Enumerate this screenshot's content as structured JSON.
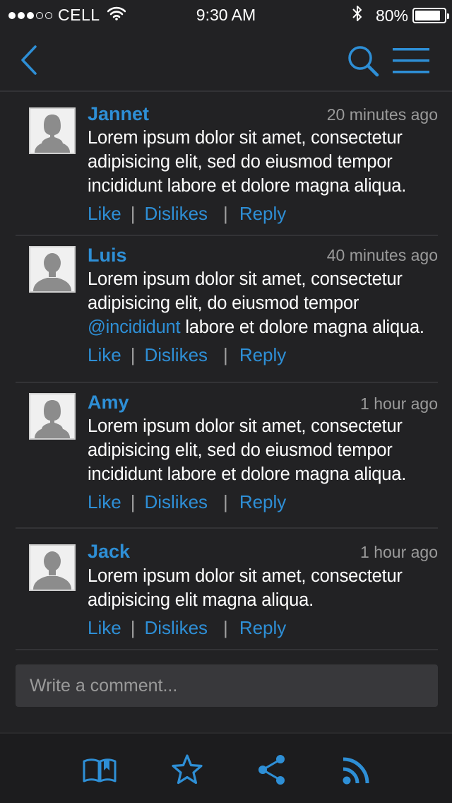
{
  "status_bar": {
    "carrier": "CELL",
    "time": "9:30 AM",
    "battery": "80%",
    "signal_icon": "signal-dots-icon",
    "wifi_icon": "wifi-icon",
    "bluetooth_icon": "bluetooth-icon",
    "battery_icon": "battery-icon"
  },
  "nav_bar": {
    "back_icon": "chevron-left-icon",
    "search_icon": "search-icon",
    "menu_icon": "hamburger-menu-icon"
  },
  "colors": {
    "background": "#222224",
    "accent": "#2e8fd6",
    "text": "#ffffff",
    "muted": "#9a9a9a",
    "input_bg": "#38383b"
  },
  "comments": [
    {
      "name": "Jannet",
      "time": "20 minutes ago",
      "avatar": "female-avatar-icon",
      "body_before": "Lorem ipsum dolor sit amet, consectetur adipisicing elit, sed do eiusmod tempor incididunt labore et dolore magna aliqua.",
      "mention": "",
      "body_after": "",
      "actions": {
        "like": "Like",
        "dislikes": "Dislikes",
        "reply": "Reply"
      }
    },
    {
      "name": "Luis",
      "time": "40 minutes ago",
      "avatar": "male-avatar-icon",
      "body_before": "Lorem ipsum dolor sit amet, consectetur adipisicing elit, do eiusmod tempor ",
      "mention": "@incididunt",
      "body_after": " labore et dolore magna aliqua.",
      "actions": {
        "like": "Like",
        "dislikes": "Dislikes",
        "reply": "Reply"
      }
    },
    {
      "name": "Amy",
      "time": "1 hour  ago",
      "avatar": "female-avatar-icon",
      "body_before": "Lorem ipsum dolor sit amet, consectetur adipisicing elit, sed do eiusmod tempor incididunt labore et dolore magna aliqua.",
      "mention": "",
      "body_after": "",
      "actions": {
        "like": "Like",
        "dislikes": "Dislikes",
        "reply": "Reply"
      }
    },
    {
      "name": "Jack",
      "time": "1 hour ago",
      "avatar": "male-avatar-icon",
      "body_before": "Lorem ipsum dolor sit amet, consectetur adipisicing elit magna aliqua.",
      "mention": "",
      "body_after": "",
      "actions": {
        "like": "Like",
        "dislikes": "Dislikes",
        "reply": "Reply"
      }
    }
  ],
  "compose": {
    "placeholder": "Write a comment...",
    "value": ""
  },
  "tab_bar": {
    "items": [
      "book-icon",
      "star-icon",
      "share-icon",
      "rss-icon"
    ]
  },
  "separators": {
    "bar": "|"
  }
}
